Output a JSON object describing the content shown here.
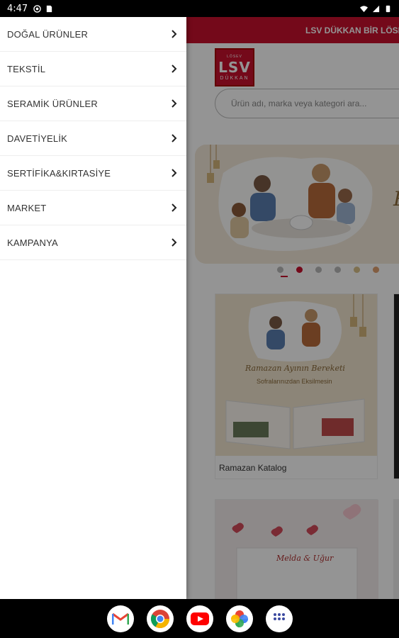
{
  "status_bar": {
    "time": "4:47",
    "left_icons": [
      "vpn-icon",
      "sim-card-icon"
    ],
    "right_icons": [
      "wifi-icon",
      "signal-icon",
      "battery-icon"
    ]
  },
  "drawer": {
    "items": [
      {
        "label": "DOĞAL ÜRÜNLER"
      },
      {
        "label": "TEKSTİL"
      },
      {
        "label": "SERAMİK ÜRÜNLER"
      },
      {
        "label": "DAVETİYELİK"
      },
      {
        "label": "SERTİFİKA&KIRTASİYE"
      },
      {
        "label": "MARKET"
      },
      {
        "label": "KAMPANYA"
      }
    ]
  },
  "page": {
    "promo_text": "LSV DÜKKAN BİR LÖSEV",
    "logo": {
      "top": "LÖSEV",
      "main": "LSV",
      "sub": "DÜKKAN"
    },
    "search_placeholder": "Ürün adı, marka veya kategori ara...",
    "hero_text": "R",
    "card1": {
      "title": "Ramazan Katalog",
      "script_text": "Ramazan Ayının Bereketi",
      "subtitle": "Sofralarınızdan Eksilmesin"
    },
    "card3": {
      "names": "Melda & Uğur"
    }
  },
  "dock": {
    "apps": [
      "gmail-icon",
      "chrome-icon",
      "youtube-icon",
      "photos-icon",
      "app-drawer-icon"
    ]
  },
  "colors": {
    "brand_red": "#c8102e"
  }
}
